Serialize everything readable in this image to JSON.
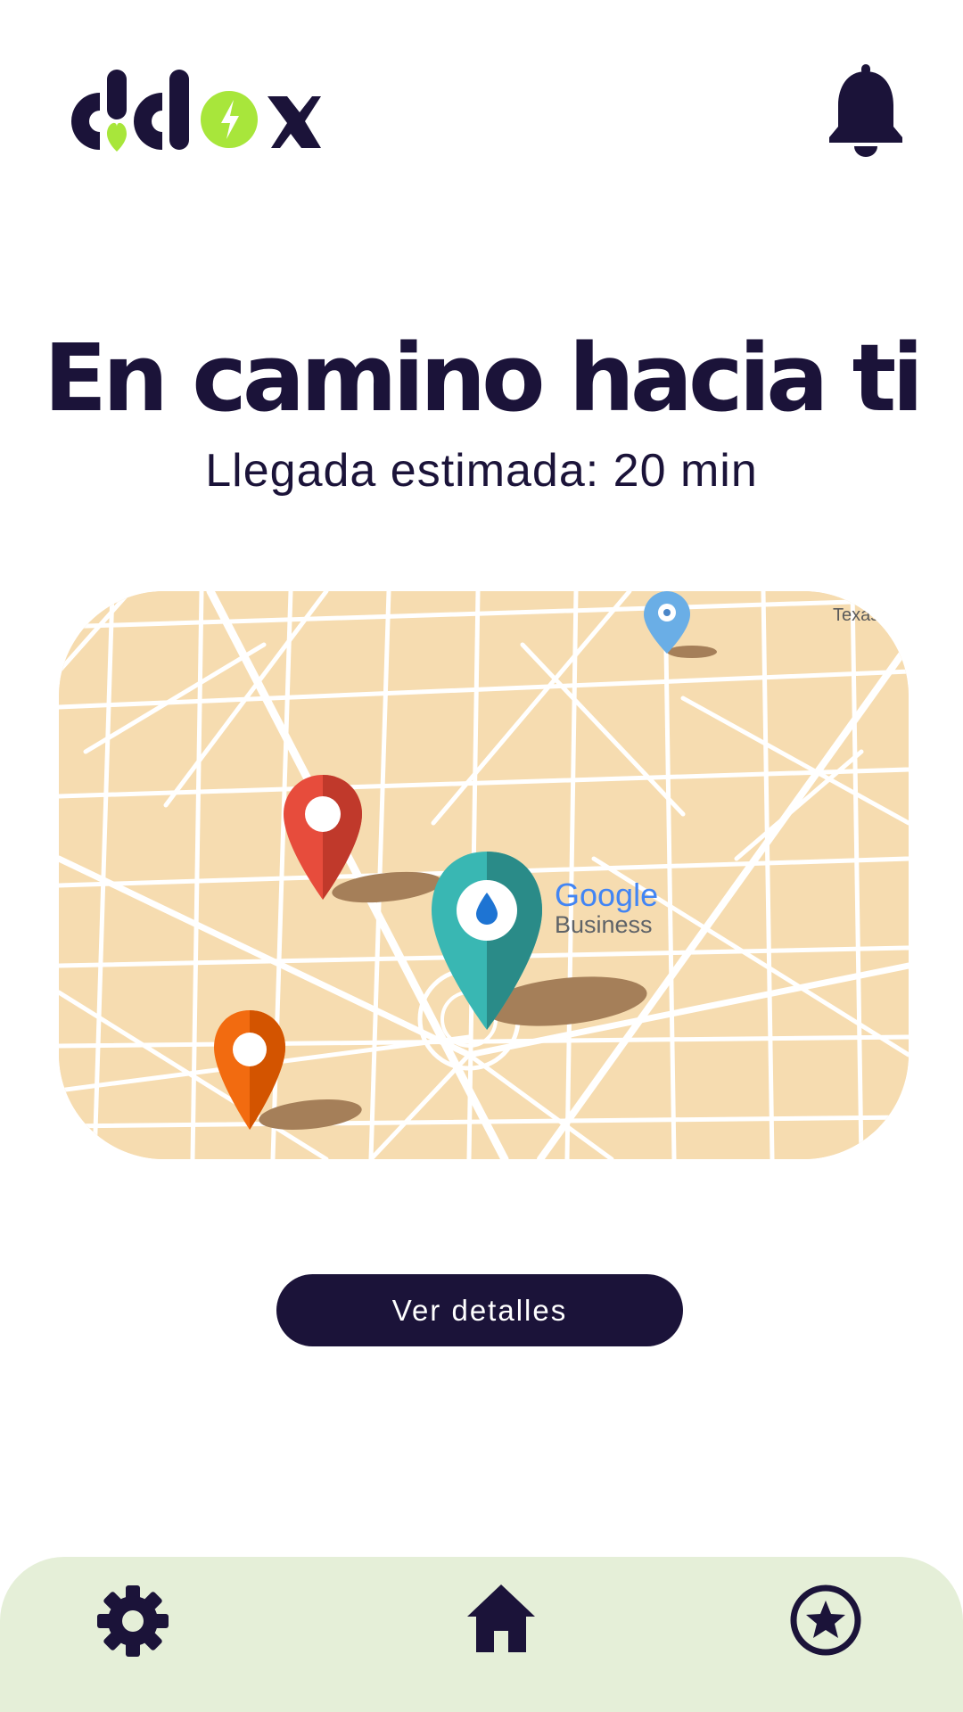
{
  "header": {
    "logo_text": "ciclox",
    "bell_icon": "bell-icon"
  },
  "hero": {
    "title": "En camino hacia ti",
    "subtitle": "Llegada estimada: 20 min"
  },
  "map": {
    "labels": {
      "google_brand": "Google",
      "google_business": "Business",
      "corner_place": "Texas"
    },
    "pins": [
      {
        "name": "red-pin",
        "color": "#e74c3c"
      },
      {
        "name": "orange-pin",
        "color": "#f26b10"
      },
      {
        "name": "teal-pin",
        "color": "#39b7b3"
      },
      {
        "name": "blue-pin",
        "color": "#6aaee6"
      }
    ]
  },
  "actions": {
    "details_label": "Ver detalles"
  },
  "bottom_nav": {
    "items": [
      {
        "id": "settings",
        "icon": "gear-icon"
      },
      {
        "id": "home",
        "icon": "home-icon"
      },
      {
        "id": "favorites",
        "icon": "star-circle-icon"
      }
    ]
  },
  "colors": {
    "primary": "#1b1339",
    "accent": "#a8e63b",
    "map_background": "#f6dcb0",
    "nav_background": "#e5efd8"
  }
}
